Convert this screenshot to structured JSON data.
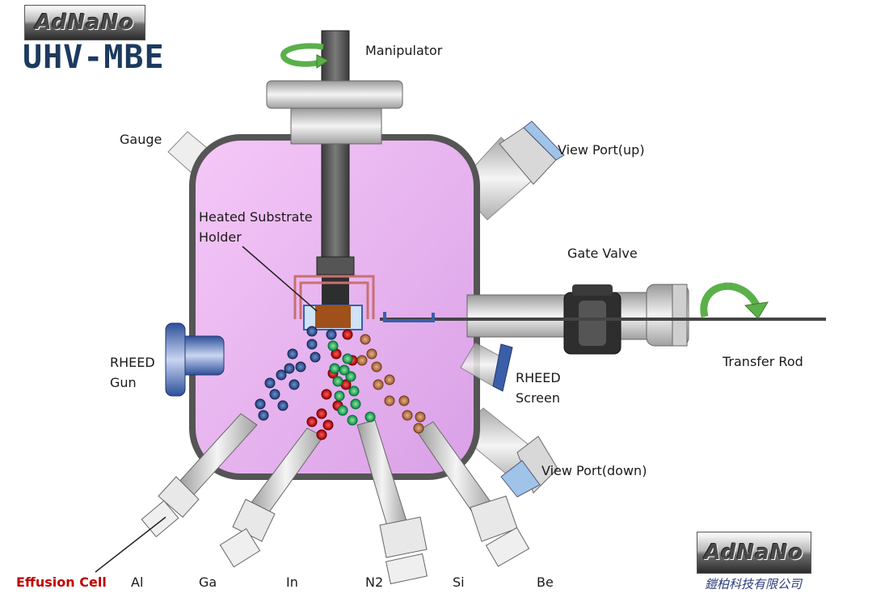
{
  "logo_text": "AdNaNo",
  "title": "UHV-MBE",
  "company": "鎧柏科技有限公司",
  "labels": {
    "manipulator": "Manipulator",
    "gauge": "Gauge",
    "view_port_up": "View Port(up)",
    "heated_substrate_line1": "Heated Substrate",
    "heated_substrate_line2": "Holder",
    "gate_valve": "Gate Valve",
    "rheed_gun_line1": "RHEED",
    "rheed_gun_line2": "Gun",
    "transfer_rod": "Transfer Rod",
    "rheed_screen_line1": "RHEED",
    "rheed_screen_line2": "Screen",
    "view_port_down": "View Port(down)",
    "effusion_cell": "Effusion Cell"
  },
  "sources": [
    "Al",
    "Ga",
    "In",
    "N2",
    "Si",
    "Be"
  ],
  "colors": {
    "chamber_fill": "#e9b8f0",
    "chamber_stroke": "#555555",
    "beam_blue": "#1f3f7a",
    "beam_red": "#b30000",
    "beam_green": "#14a050",
    "beam_brown": "#b06a3c",
    "rotation_arrow": "#5bb04a",
    "title": "#1c3a5e",
    "effusion_label": "#c00000"
  }
}
